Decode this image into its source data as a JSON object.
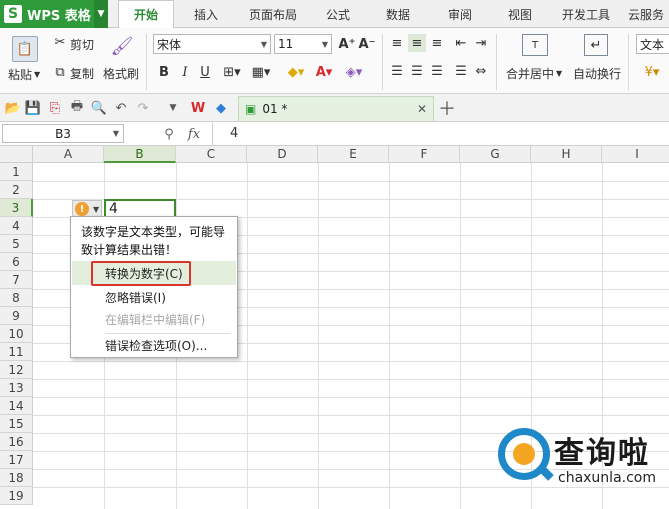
{
  "app": {
    "name": "WPS 表格",
    "logo_letter": "S"
  },
  "tabs": [
    "开始",
    "插入",
    "页面布局",
    "公式",
    "数据",
    "审阅",
    "视图",
    "开发工具",
    "云服务"
  ],
  "ribbon": {
    "paste": "粘贴",
    "cut": "剪切",
    "copy": "复制",
    "format_painter": "格式刷",
    "font_name": "宋体",
    "font_size": "11",
    "grow_font": "A⁺",
    "shrink_font": "A⁻",
    "bold": "B",
    "italic": "I",
    "underline": "U",
    "merge_center": "合并居中",
    "wrap_text": "自动换行",
    "number_format": "文本"
  },
  "doc_tab": {
    "name": "01 *"
  },
  "formula_bar": {
    "cell_ref": "B3",
    "fx": "fx",
    "content": "4"
  },
  "grid": {
    "columns": [
      "A",
      "B",
      "C",
      "D",
      "E",
      "F",
      "G",
      "H",
      "I"
    ],
    "rows": [
      "1",
      "2",
      "3",
      "4",
      "5",
      "6",
      "7",
      "8",
      "9",
      "10",
      "11",
      "12",
      "13",
      "14",
      "15",
      "16",
      "17",
      "18",
      "19"
    ],
    "active_cell_value": "4"
  },
  "error_popup": {
    "message": "该数字是文本类型，可能导致计算结果出错！",
    "items": [
      {
        "label": "转换为数字(C)",
        "enabled": true,
        "highlighted": true
      },
      {
        "label": "忽略错误(I)",
        "enabled": true
      },
      {
        "label": "在编辑栏中编辑(F)",
        "enabled": false
      },
      {
        "label": "错误检查选项(O)...",
        "enabled": true
      }
    ]
  },
  "watermark": {
    "brand": "查询啦",
    "url": "chaxunla.com"
  },
  "colors": {
    "accent": "#2e9a3a",
    "highlight_box": "#d9352c",
    "warning": "#f0a030"
  }
}
